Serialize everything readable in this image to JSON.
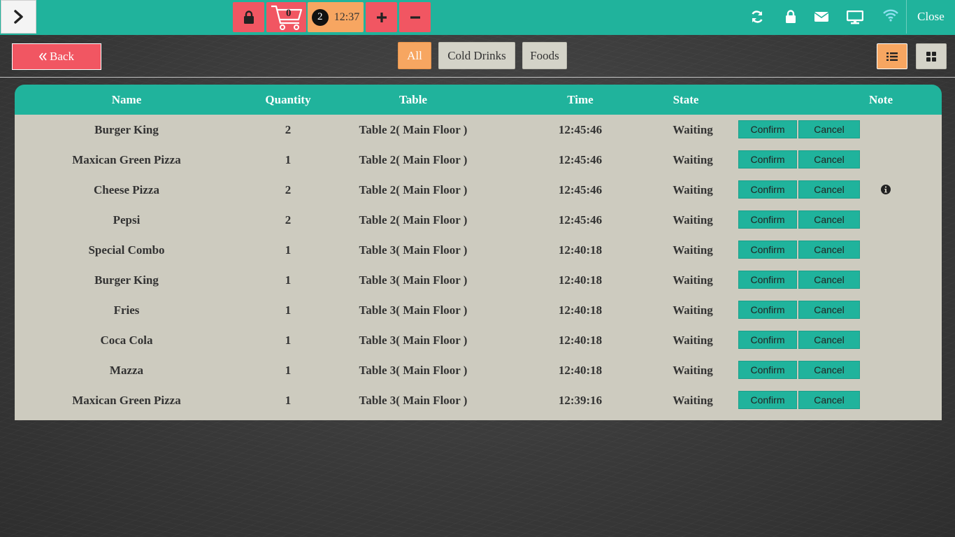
{
  "topbar": {
    "cart_count": "0",
    "timer_badge": "2",
    "timer_time": "12:37",
    "close_label": "Close"
  },
  "toolbar": {
    "back_label": "Back",
    "filters": [
      "All",
      "Cold Drinks",
      "Foods"
    ],
    "active_filter": "All"
  },
  "orders": {
    "columns": [
      "Name",
      "Quantity",
      "Table",
      "Time",
      "State",
      "Note"
    ],
    "confirm_label": "Confirm",
    "cancel_label": "Cancel",
    "rows": [
      {
        "name": "Burger King",
        "quantity": "2",
        "table": "Table 2( Main Floor )",
        "time": "12:45:46",
        "state": "Waiting",
        "has_note": false
      },
      {
        "name": "Maxican Green Pizza",
        "quantity": "1",
        "table": "Table 2( Main Floor )",
        "time": "12:45:46",
        "state": "Waiting",
        "has_note": false
      },
      {
        "name": "Cheese Pizza",
        "quantity": "2",
        "table": "Table 2( Main Floor )",
        "time": "12:45:46",
        "state": "Waiting",
        "has_note": true
      },
      {
        "name": "Pepsi",
        "quantity": "2",
        "table": "Table 2( Main Floor )",
        "time": "12:45:46",
        "state": "Waiting",
        "has_note": false
      },
      {
        "name": "Special Combo",
        "quantity": "1",
        "table": "Table 3( Main Floor )",
        "time": "12:40:18",
        "state": "Waiting",
        "has_note": false
      },
      {
        "name": "Burger King",
        "quantity": "1",
        "table": "Table 3( Main Floor )",
        "time": "12:40:18",
        "state": "Waiting",
        "has_note": false
      },
      {
        "name": "Fries",
        "quantity": "1",
        "table": "Table 3( Main Floor )",
        "time": "12:40:18",
        "state": "Waiting",
        "has_note": false
      },
      {
        "name": "Coca Cola",
        "quantity": "1",
        "table": "Table 3( Main Floor )",
        "time": "12:40:18",
        "state": "Waiting",
        "has_note": false
      },
      {
        "name": "Mazza",
        "quantity": "1",
        "table": "Table 3( Main Floor )",
        "time": "12:40:18",
        "state": "Waiting",
        "has_note": false
      },
      {
        "name": "Maxican Green Pizza",
        "quantity": "1",
        "table": "Table 3( Main Floor )",
        "time": "12:39:16",
        "state": "Waiting",
        "has_note": false
      }
    ]
  },
  "colors": {
    "accent": "#20b39c",
    "danger": "#f15662",
    "warning": "#f7a661",
    "table_body": "#cdcbbf"
  },
  "icons": [
    "chevron-right-icon",
    "lock-icon",
    "cart-icon",
    "plus-icon",
    "minus-icon",
    "refresh-icon",
    "lock-icon",
    "envelope-icon",
    "monitor-icon",
    "wifi-icon",
    "double-chevron-left-icon",
    "list-view-icon",
    "grid-view-icon",
    "info-icon"
  ]
}
